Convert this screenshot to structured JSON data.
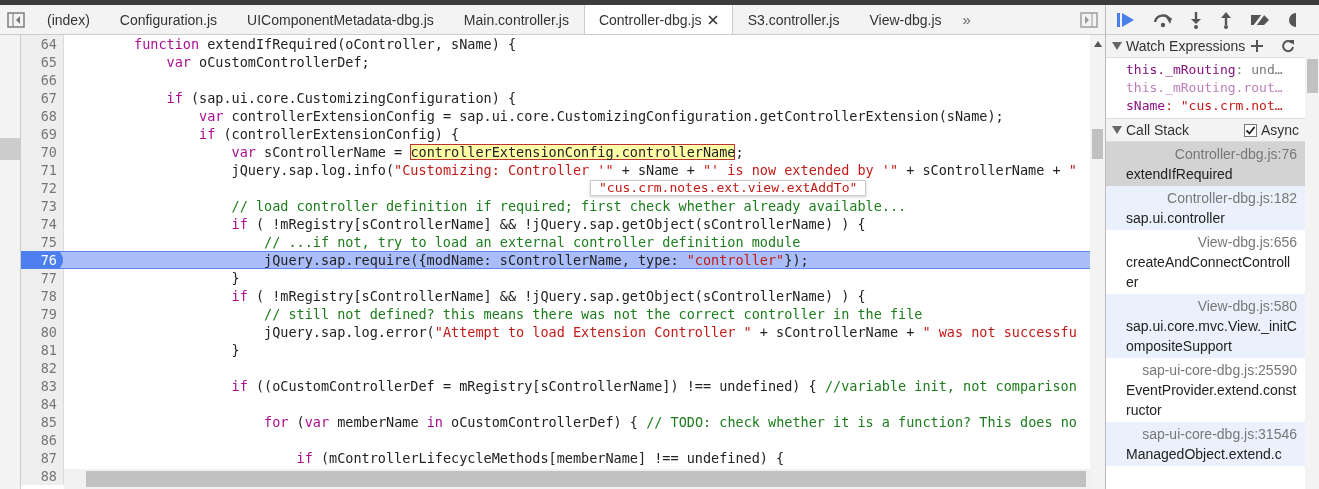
{
  "editor_tabs": [
    {
      "label": "(index)",
      "selected": false,
      "closable": false
    },
    {
      "label": "Configuration.js",
      "selected": false,
      "closable": false
    },
    {
      "label": "UIComponentMetadata-dbg.js",
      "selected": false,
      "closable": false
    },
    {
      "label": "Main.controller.js",
      "selected": false,
      "closable": false
    },
    {
      "label": "Controller-dbg.js",
      "selected": true,
      "closable": true
    },
    {
      "label": "S3.controller.js",
      "selected": false,
      "closable": false
    },
    {
      "label": "View-dbg.js",
      "selected": false,
      "closable": false
    }
  ],
  "more_tabs": "»",
  "code_lines": [
    {
      "number": "64",
      "current": false,
      "tokens": [
        {
          "kind": "kw",
          "text": "        function"
        },
        {
          "kind": "plain",
          "text": " extendIfRequired(oController, sName) {"
        }
      ]
    },
    {
      "number": "65",
      "current": false,
      "tokens": [
        {
          "kind": "kw",
          "text": "            var"
        },
        {
          "kind": "plain",
          "text": " oCustomControllerDef;"
        }
      ]
    },
    {
      "number": "66",
      "current": false
    },
    {
      "number": "67",
      "current": false,
      "tokens": [
        {
          "kind": "kw",
          "text": "            if"
        },
        {
          "kind": "plain",
          "text": " (sap.ui.core.CustomizingConfiguration) {"
        }
      ]
    },
    {
      "number": "68",
      "current": false,
      "tokens": [
        {
          "kind": "kw",
          "text": "                var"
        },
        {
          "kind": "plain",
          "text": " controllerExtensionConfig = sap.ui.core.CustomizingConfiguration.getControllerExtension(sName);"
        }
      ]
    },
    {
      "number": "69",
      "current": false,
      "tokens": [
        {
          "kind": "kw",
          "text": "                if"
        },
        {
          "kind": "plain",
          "text": " (controllerExtensionConfig) {"
        }
      ]
    },
    {
      "number": "70",
      "current": false,
      "tokens": [
        {
          "kind": "kw",
          "text": "                    var"
        },
        {
          "kind": "plain",
          "text": " sControllerName = "
        },
        {
          "kind": "highlight",
          "text": "controllerExtensionConfig.controllerName"
        },
        {
          "kind": "plain",
          "text": ";"
        }
      ]
    },
    {
      "number": "71",
      "current": false,
      "tokens": [
        {
          "kind": "plain",
          "text": "                    jQuery.sap.log.info("
        },
        {
          "kind": "str",
          "text": "\"Customizing: Controller '\""
        },
        {
          "kind": "plain",
          "text": " + sName + "
        },
        {
          "kind": "str",
          "text": "\"' is now extended by '\""
        },
        {
          "kind": "plain",
          "text": " + sControllerName + "
        },
        {
          "kind": "str",
          "text": "\""
        }
      ]
    },
    {
      "number": "72",
      "current": false
    },
    {
      "number": "73",
      "current": false,
      "tokens": [
        {
          "kind": "cmt",
          "text": "                    // load controller definition if required; first check whether already available..."
        }
      ]
    },
    {
      "number": "74",
      "current": false,
      "tokens": [
        {
          "kind": "kw",
          "text": "                    if"
        },
        {
          "kind": "plain",
          "text": " ( !mRegistry[sControllerName] && !jQuery.sap.getObject(sControllerName) ) {"
        }
      ]
    },
    {
      "number": "75",
      "current": false,
      "tokens": [
        {
          "kind": "cmt",
          "text": "                        // ...if not, try to load an external controller definition module"
        }
      ]
    },
    {
      "number": "76",
      "current": true,
      "tokens": [
        {
          "kind": "plain",
          "text": "                        jQuery.sap.require({modName: sControllerName, type: "
        },
        {
          "kind": "str",
          "text": "\"controller\""
        },
        {
          "kind": "plain",
          "text": "});"
        }
      ]
    },
    {
      "number": "77",
      "current": false,
      "tokens": [
        {
          "kind": "plain",
          "text": "                    }"
        }
      ]
    },
    {
      "number": "78",
      "current": false,
      "tokens": [
        {
          "kind": "kw",
          "text": "                    if"
        },
        {
          "kind": "plain",
          "text": " ( !mRegistry[sControllerName] && !jQuery.sap.getObject(sControllerName) ) {"
        }
      ]
    },
    {
      "number": "79",
      "current": false,
      "tokens": [
        {
          "kind": "cmt",
          "text": "                        // still not defined? this means there was not the correct controller in the file"
        }
      ]
    },
    {
      "number": "80",
      "current": false,
      "tokens": [
        {
          "kind": "plain",
          "text": "                        jQuery.sap.log.error("
        },
        {
          "kind": "str",
          "text": "\"Attempt to load Extension Controller \""
        },
        {
          "kind": "plain",
          "text": " + sControllerName + "
        },
        {
          "kind": "str",
          "text": "\" was not successfu"
        }
      ]
    },
    {
      "number": "81",
      "current": false,
      "tokens": [
        {
          "kind": "plain",
          "text": "                    }"
        }
      ]
    },
    {
      "number": "82",
      "current": false
    },
    {
      "number": "83",
      "current": false,
      "tokens": [
        {
          "kind": "kw",
          "text": "                    if"
        },
        {
          "kind": "plain",
          "text": " ((oCustomControllerDef = mRegistry[sControllerName]) !== undefined) { "
        },
        {
          "kind": "cmt",
          "text": "//variable init, not comparison"
        }
      ]
    },
    {
      "number": "84",
      "current": false
    },
    {
      "number": "85",
      "current": false,
      "tokens": [
        {
          "kind": "kw",
          "text": "                        for"
        },
        {
          "kind": "plain",
          "text": " ("
        },
        {
          "kind": "kw",
          "text": "var"
        },
        {
          "kind": "plain",
          "text": " memberName "
        },
        {
          "kind": "kw",
          "text": "in"
        },
        {
          "kind": "plain",
          "text": " oCustomControllerDef) { "
        },
        {
          "kind": "cmt",
          "text": "// TODO: check whether it is a function? This does no"
        }
      ]
    },
    {
      "number": "86",
      "current": false
    },
    {
      "number": "87",
      "current": false,
      "tokens": [
        {
          "kind": "kw",
          "text": "                            if"
        },
        {
          "kind": "plain",
          "text": " (mControllerLifecycleMethods[memberName] !== undefined) {"
        }
      ]
    },
    {
      "number": "88",
      "current": false
    }
  ],
  "value_tooltip": "\"cus.crm.notes.ext.view.extAddTo\"",
  "watch_expressions": {
    "title": "Watch Expressions",
    "expanded": true,
    "items": [
      {
        "name": "this._mRouting",
        "value": ": und…",
        "kind": "undefined",
        "error": false
      },
      {
        "name": "this._mRouting.rout…",
        "error": true
      },
      {
        "name": "sName",
        "value": ": \"cus.crm.not…",
        "kind": "string",
        "error": false
      }
    ]
  },
  "call_stack": {
    "title": "Call Stack",
    "expanded": true,
    "async_label": "Async",
    "async_checked": true,
    "frames": [
      {
        "location": "Controller-dbg.js:76",
        "function": "extendIfRequired",
        "selected": true
      },
      {
        "location": "Controller-dbg.js:182",
        "function": "sap.ui.controller",
        "selected": false
      },
      {
        "location": "View-dbg.js:656",
        "function": "createAndConnectController",
        "selected": false
      },
      {
        "location": "View-dbg.js:580",
        "function": "sap.ui.core.mvc.View._initCompositeSupport",
        "selected": false
      },
      {
        "location": "sap-ui-core-dbg.js:25590",
        "function": "EventProvider.extend.constructor",
        "selected": false
      },
      {
        "location": "sap-ui-core-dbg.js:31546",
        "function": "ManagedObject.extend.c",
        "selected": false
      }
    ]
  }
}
